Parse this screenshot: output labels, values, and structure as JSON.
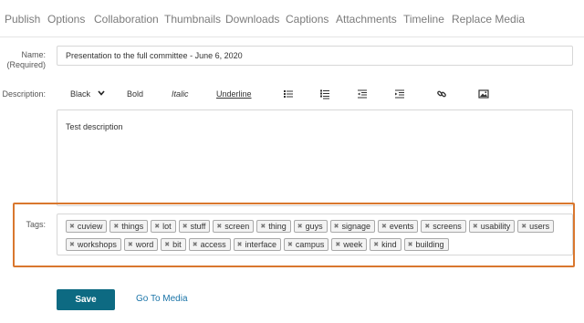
{
  "tabs": [
    "Publish",
    "Options",
    "Collaboration",
    "Thumbnails",
    "Downloads",
    "Captions",
    "Attachments",
    "Timeline",
    "Replace Media"
  ],
  "form": {
    "name_label": "Name:",
    "name_required": "(Required)",
    "name_value": "Presentation to the full committee - June 6, 2020",
    "description_label": "Description:",
    "description_text": "Test description",
    "tags_label": "Tags:"
  },
  "toolbar": {
    "color_label": "Black",
    "bold_label": "Bold",
    "italic_label": "Italic",
    "underline_label": "Underline",
    "icons": [
      "bulleted-list-icon",
      "numbered-list-icon",
      "outdent-icon",
      "indent-icon",
      "link-icon",
      "image-icon"
    ]
  },
  "tags": {
    "row1": [
      "cuview",
      "things",
      "lot",
      "stuff",
      "screen",
      "thing",
      "guys",
      "signage",
      "events",
      "screens",
      "usability",
      "users"
    ],
    "row2": [
      "workshops",
      "word",
      "bit",
      "access",
      "interface",
      "campus",
      "week",
      "kind",
      "building"
    ]
  },
  "actions": {
    "save_label": "Save",
    "goto_label": "Go To Media"
  },
  "colors": {
    "accent": "#0d6a82",
    "highlight": "#d9772e",
    "link": "#1a74a8"
  }
}
